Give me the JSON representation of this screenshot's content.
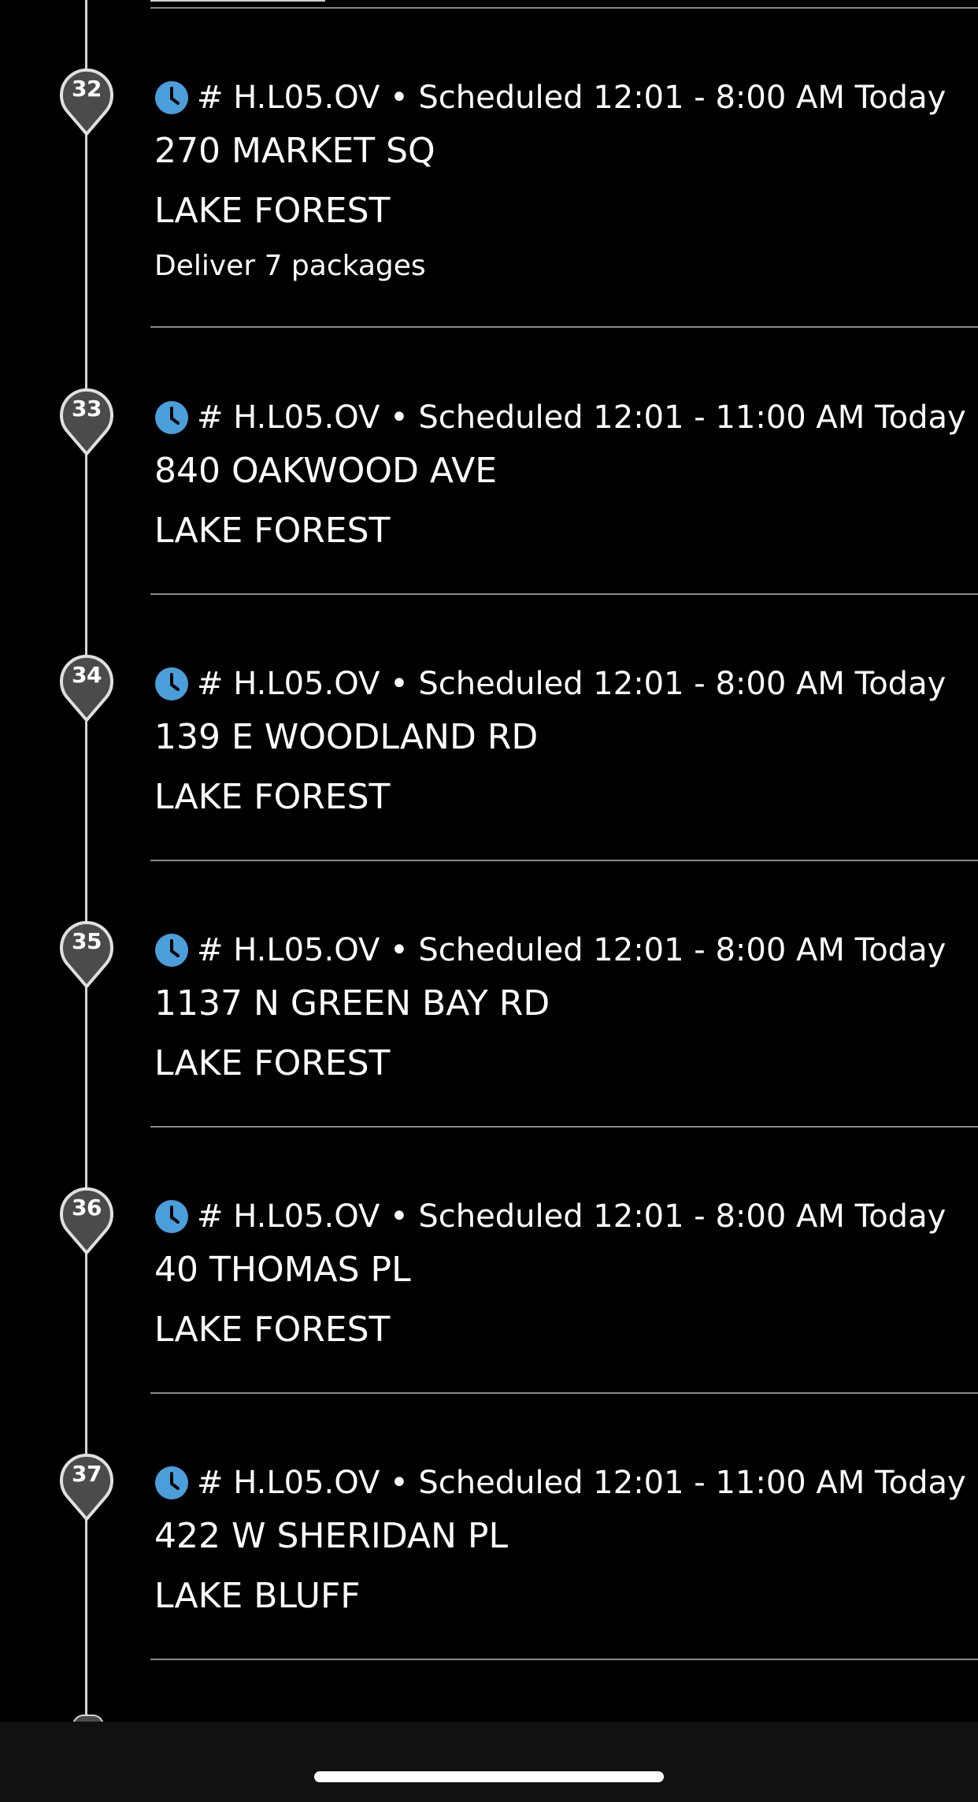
{
  "colors": {
    "background": "#000000",
    "text": "#ffffff",
    "clock_accent": "#4a9fdb",
    "pin_fill": "#4b4b4b",
    "pin_stroke": "#e0e0e0",
    "timeline": "#d7d7d7",
    "divider": "#8a8a8a",
    "home_bar_bg": "#111111"
  },
  "icons": {
    "schedule": "clock-icon",
    "stop_marker": "map-pin-icon"
  },
  "stops": [
    {
      "number": "32",
      "meta": "# H.L05.OV • Scheduled 12:01 - 8:00 AM Today",
      "address": "270 MARKET SQ",
      "city": "LAKE FOREST",
      "note": "Deliver 7 packages"
    },
    {
      "number": "33",
      "meta": "# H.L05.OV • Scheduled 12:01 - 11:00 AM Today",
      "address": "840 OAKWOOD AVE",
      "city": "LAKE FOREST",
      "note": ""
    },
    {
      "number": "34",
      "meta": "# H.L05.OV • Scheduled 12:01 - 8:00 AM Today",
      "address": "139 E WOODLAND RD",
      "city": "LAKE FOREST",
      "note": ""
    },
    {
      "number": "35",
      "meta": "# H.L05.OV • Scheduled 12:01 - 8:00 AM Today",
      "address": "1137 N GREEN BAY RD",
      "city": "LAKE FOREST",
      "note": ""
    },
    {
      "number": "36",
      "meta": "# H.L05.OV • Scheduled 12:01 - 8:00 AM Today",
      "address": "40 THOMAS PL",
      "city": "LAKE FOREST",
      "note": ""
    },
    {
      "number": "37",
      "meta": "# H.L05.OV • Scheduled 12:01 - 11:00 AM Today",
      "address": "422 W SHERIDAN PL",
      "city": "LAKE BLUFF",
      "note": ""
    }
  ]
}
